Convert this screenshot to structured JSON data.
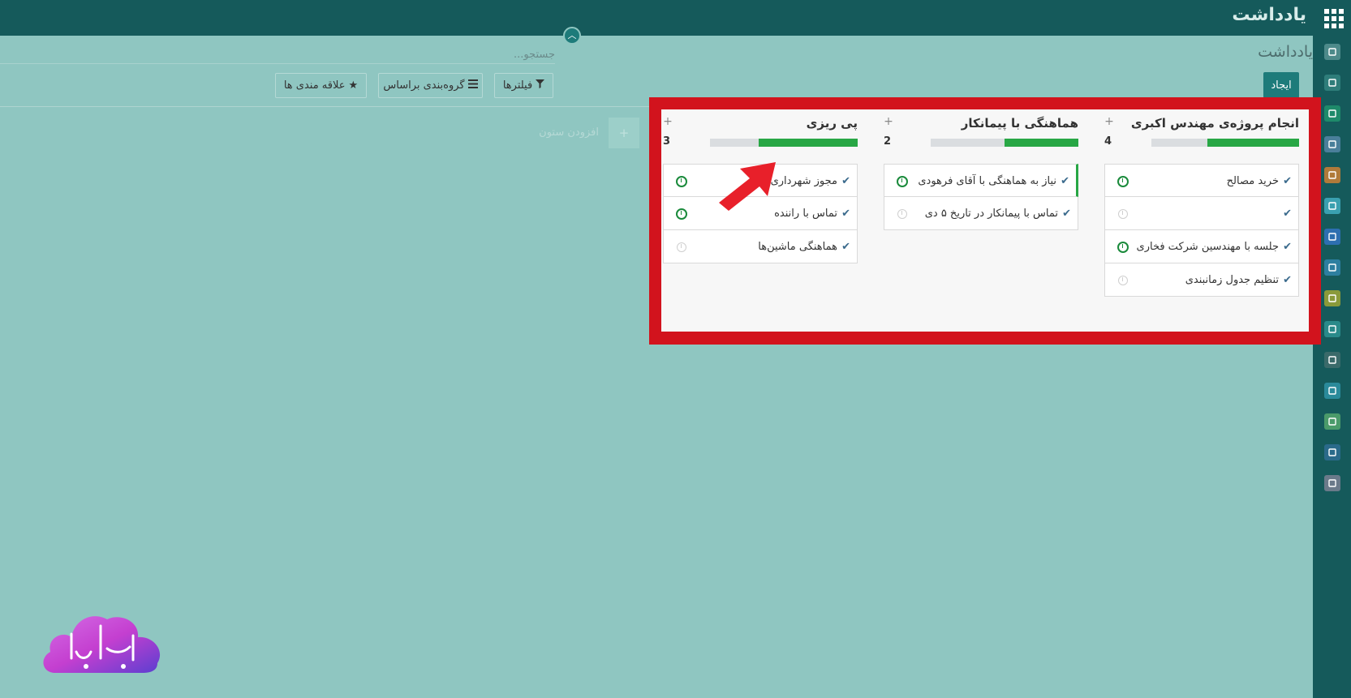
{
  "topbar": {
    "app_title": "یادداشت"
  },
  "control_panel": {
    "title": "یادداشت",
    "create_label": "ایجاد",
    "search_placeholder": "جستجو...",
    "filters_label": "فیلترها",
    "groupby_label": "گروه‌بندی براساس",
    "favorites_label": "علاقه مندی ها"
  },
  "add_column": {
    "label": "افزودن ستون"
  },
  "columns": [
    {
      "title": "انجام پروژه‌ی مهندس اکبری",
      "count": "4",
      "progress": 0.62,
      "cards": [
        {
          "text": "خرید مصالح",
          "status": "done"
        },
        {
          "text": "",
          "status": "idle"
        },
        {
          "text": "جلسه با مهندسین شرکت فخاری",
          "status": "done"
        },
        {
          "text": "تنظیم جدول زمانبندی",
          "status": "idle"
        }
      ]
    },
    {
      "title": "هماهنگی با پیمانکار",
      "count": "2",
      "progress": 0.5,
      "cards": [
        {
          "text": "نیاز به هماهنگی با آقای فرهودی",
          "status": "done"
        },
        {
          "text": "تماس با پیمانکار در تاریخ ۵ دی",
          "status": "idle"
        }
      ]
    },
    {
      "title": "پی ریزی",
      "count": "3",
      "progress": 0.67,
      "cards": [
        {
          "text": "مجوز شهرداری",
          "status": "done"
        },
        {
          "text": "تماس با راننده",
          "status": "done"
        },
        {
          "text": "هماهنگی ماشین‌ها",
          "status": "idle"
        }
      ]
    }
  ],
  "sidebar_icons": [
    "chat-icon",
    "notes-icon",
    "contacts-icon",
    "website-icon",
    "reports-icon",
    "support-icon",
    "list-icon",
    "documents-icon",
    "invoice-icon",
    "puzzle-icon",
    "timer-icon",
    "team-icon",
    "employees-icon",
    "payroll-icon",
    "dashboard-icon"
  ],
  "sidebar_colors": [
    "#4d8a8a",
    "#2e7d7a",
    "#1e8a6a",
    "#4a7f9a",
    "#b07a3a",
    "#3aa0b0",
    "#2d6fb0",
    "#2d7fa0",
    "#8a9a3a",
    "#2a8a8a",
    "#3a6a6a",
    "#2a8a9a",
    "#4a9a6a",
    "#2a6a8a",
    "#6a7a8a"
  ],
  "logo": {
    "text": "پامیکا"
  },
  "colors": {
    "topbar": "#155a5b",
    "background": "#8fc6c1",
    "highlight": "#d2131d",
    "progress_done": "#28a745"
  }
}
